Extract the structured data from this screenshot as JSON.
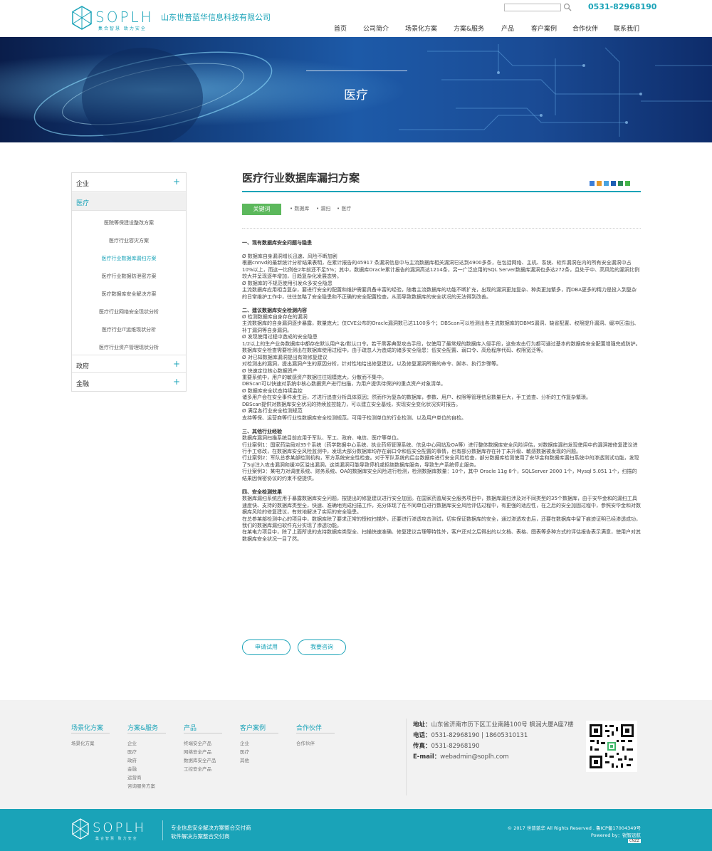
{
  "header": {
    "logo_text": "SOPLH",
    "logo_slogan": "集合智慧 致力安全",
    "company": "山东世普蓝华信息科技有限公司",
    "phone": "0531-82968190",
    "search_placeholder": "",
    "nav": [
      "首页",
      "公司简介",
      "场景化方案",
      "方案&服务",
      "产品",
      "客户案例",
      "合作伙伴",
      "联系我们"
    ]
  },
  "banner": {
    "title": "医疗"
  },
  "sidebar": {
    "categories": [
      {
        "label": "企业",
        "icon": "plus-icon",
        "active": false
      },
      {
        "label": "医疗",
        "active": true
      },
      {
        "label": "政府",
        "icon": "plus-icon",
        "active": false
      },
      {
        "label": "金融",
        "icon": "plus-icon",
        "active": false
      }
    ],
    "plus": "+",
    "sub_items": [
      "医院等保建设整改方案",
      "医疗行业容灾方案",
      "医疗行业数据库漏扫方案",
      "医疗行业数据防泄密方案",
      "医疗数据库安全解决方案",
      "医疗行业网络安全现状分析",
      "医疗行业IT运维现状分析",
      "医疗行业资产管理现状分析"
    ],
    "current_sub_index": 2
  },
  "article": {
    "title": "医疗行业数据库漏扫方案",
    "share_icons": [
      "share-qzone-icon",
      "share-weibo-icon",
      "share-tencent-icon",
      "share-renren-icon",
      "share-douban-icon",
      "share-wechat-icon"
    ],
    "keyword_label": "关键词",
    "keywords": [
      "数据库",
      "漏扫",
      "医疗"
    ],
    "blocks": [
      {
        "type": "h",
        "text": "一、现有数据库安全问题与隐患"
      },
      {
        "type": "gap"
      },
      {
        "type": "p",
        "text": "Ø 数据库自身漏洞增长迅速、风险不断加剧"
      },
      {
        "type": "p",
        "text": "根据cnnvd的最新统计分析结果表明，在累计报告的45917 条漏洞信息中与主流数据库相关漏洞已达到4900多条，在包括网络、主机、系统、软件漏洞在内的所有安全漏洞中占10%以上，而这一比例在2年前还不足5%；其中，数据库Oracle累计报告的漏洞高达1214条，另一广泛应用的SQL Server数据库漏洞也多达272条，且处于中、高风险的漏洞比例较大并呈现逐年增加，日趋复杂化发展态势。"
      },
      {
        "type": "p",
        "text": "Ø 数据库的不规范使用引发众多安全隐患"
      },
      {
        "type": "p",
        "text": "主流数据库应用相当复杂，要进行安全的配置和维护需要具备丰富的经验，随着主流数据库的功能不断扩充，出现的漏洞更加复杂、种类更加繁多，而DBA更多的精力是投入到复杂的日常维护工作中，往往忽略了安全隐患和不正确的安全配置检查，从而导致数据库的安全状况的无法得到改善。"
      },
      {
        "type": "gap"
      },
      {
        "type": "h",
        "text": "二、建议数据库安全检测内容"
      },
      {
        "type": "p",
        "text": "Ø 检测数据库自身存在的漏洞"
      },
      {
        "type": "p",
        "text": "主流数据库的自身漏洞逐步暴露，数量庞大；仅CVE公布的Oracle漏洞数已达1100多个；DBScan可以检测出各主流数据库的DBMS漏洞、缺省配置、权限提升漏洞、缓冲区溢出、补丁漏洞等自身漏洞。"
      },
      {
        "type": "p",
        "text": "Ø 发现使用过程中造成的安全隐患"
      },
      {
        "type": "p",
        "text": "1/2以上的生产业务数据库中都存在默认用户名/默认口令。若干黑客典型攻击手段，仅使用了最常规的数据库入侵手段，这些攻击行为都可通过基本的数据库安全配置增强完成防护。"
      },
      {
        "type": "p",
        "text": "数据库安全检查需要检测出在数据库使用过程中，由于疏忽人为造成的诸多安全隐患：低安全配置、弱口令、高危程序代码、权限宽泛等。"
      },
      {
        "type": "p",
        "text": "Ø 对已知数据库漏洞提出有效修复建议"
      },
      {
        "type": "p",
        "text": "对检测出的漏洞，提出漏洞产生的原因分析，针对性地给出修复建议，以及修复漏洞所需的命令、脚本、执行步骤等。"
      },
      {
        "type": "p",
        "text": "Ø 快速定位核心数据资产"
      },
      {
        "type": "p",
        "text": "重要系统中，用户的敏感资产数据往往规模庞大，分散而不集中。"
      },
      {
        "type": "p",
        "text": "DBScan可以快速对系统中核心数据资产进行扫描，为用户提供待保护的重点资产对象清单。"
      },
      {
        "type": "p",
        "text": "Ø 数据库安全状态持续监控"
      },
      {
        "type": "p",
        "text": "诸多用户会在安全事件发生后，才进行追查分析具体原因；然而作为复杂的数据库，参数、用户、权限等管理信息数量巨大，手工追查、分析的工作复杂繁琐。"
      },
      {
        "type": "p",
        "text": "DBScan提供对数据库安全状况的持续监控能力，可以建立安全基线，实现安全变化状况实时报告。"
      },
      {
        "type": "p",
        "text": "Ø 满足各行业安全检测规范"
      },
      {
        "type": "p",
        "text": "支持等保、运营商等行业性数据库安全检测规范，可用于检测单位的行业检测、以及用户单位的自检。"
      },
      {
        "type": "gap"
      },
      {
        "type": "h",
        "text": "三、其他行业经验"
      },
      {
        "type": "p",
        "text": "数据库漏洞扫描系统目前应用于军队、军工、政府、电信、医疗等单位。"
      },
      {
        "type": "p",
        "text": "行业案例1：国家药监局对35个系统（药学数据中心系统、执业药师管理系统、信息中心网站及OA等）进行整体数据库安全风险评估，对数据库漏扫发现使用中的漏洞按修复建议进行手工修改，在数据库安全风险监测中，发现大部分数据库均存在弱口令和低安全配置的事情，也有部分数据库存在补丁未升级、敏感数据被发现的问题。"
      },
      {
        "type": "p",
        "text": "行业案例2：军队总参某部检测机构，军方系统安全性检查。对于军队系统的后台数据库进行安全风险检查，部分数据库检测使用了安华金和数据库漏扫系统中的渗透测试功能，发现了Sql注入攻击漏洞和缓冲区溢出漏洞，这类漏洞可能导致停机或拒绝数据库服务，导致生产系统停止服务。"
      },
      {
        "type": "p",
        "text": "行业案例3：某电力对调度系统、财务系统、OA的数据库安全风险进行检测，检测数据库数量：10个，其中 Oracle 11g 8个，SQLServer 2000 1个，Mysql 5.051 1个，扫描的结果因保密协议的约束不便提供。"
      },
      {
        "type": "gap"
      },
      {
        "type": "h",
        "text": "四、安全检测效果"
      },
      {
        "type": "p",
        "text": "数据库漏扫系统应用于暴露数据库安全问题，按提出的修复建议进行安全加固。在国家药监局安全服务项目中，数据库漏扫涉及对不同类型的35个数据库，由于安华金和的漏扫工具速度快、支持的数据库类型全，快速、准确地完成扫描工作，充分体现了在不同单位进行数据库安全风险评估过程中，有更强的适应性，在之后的安全加固过程中，参照安华金和对数据库风险的修复建议，有效地解决了实际的安全隐患。"
      },
      {
        "type": "p",
        "text": "在总参某部检测中心的项目中，数据库除了要求正常的授权扫描外，还要进行渗透攻击测试，切实保证数据库的安全，通过渗透攻击后，还要在数据库中留下痕迹证明已经渗透成功，我们的数据库漏扫软件充分实现了渗透功能。"
      },
      {
        "type": "p",
        "text": "在某电力项目中，除了上面所说的支持数据库类型全、扫描快速准确、修复建议合理等特性外，客户还对之后得出的以文档、表格、图表等多种方式的评估报告表示满意，使用户对其数据库安全状况一目了然。"
      }
    ],
    "btn_trial": "申请试用",
    "btn_consult": "我要咨询"
  },
  "footer": {
    "columns": [
      {
        "title": "场景化方案",
        "links": [
          "场景化方案"
        ]
      },
      {
        "title": "方案&服务",
        "links": [
          "企业",
          "医疗",
          "政府",
          "金融",
          "运营商",
          "咨询服务方案"
        ]
      },
      {
        "title": "产品",
        "links": [
          "终端安全产品",
          "网络安全产品",
          "数据库安全产品",
          "工控安全产品"
        ]
      },
      {
        "title": "客户案例",
        "links": [
          "企业",
          "医疗",
          "其他"
        ]
      },
      {
        "title": "合作伙伴",
        "links": [
          "合作伙伴"
        ]
      }
    ],
    "contact": [
      {
        "label": "地址：",
        "value": "山东省济南市历下区工业南路100号 枫润大厦A座7楼"
      },
      {
        "label": "电话：",
        "value": "0531-82968190 | 18605310131"
      },
      {
        "label": "传真：",
        "value": "0531-82968190"
      },
      {
        "label": "E-mail：",
        "value": "webadmin@soplh.com"
      }
    ]
  },
  "bottom": {
    "logo_text": "SOPLH",
    "slogan": "集合智慧 致力安全",
    "tag1": "专业信息安全解决方案整合交付商",
    "tag2": "软件解决方案整合交付商",
    "copyright": "© 2017 世普蓝华 All Rights Reserved . 鲁ICP备17004349号",
    "powered": "Powered by：锐智远航",
    "badge": "CNZZ"
  },
  "colors": {
    "accent": "#1aa3b8",
    "keyword_badge": "#5cb85c",
    "footer_bg": "#f2f2f2"
  }
}
